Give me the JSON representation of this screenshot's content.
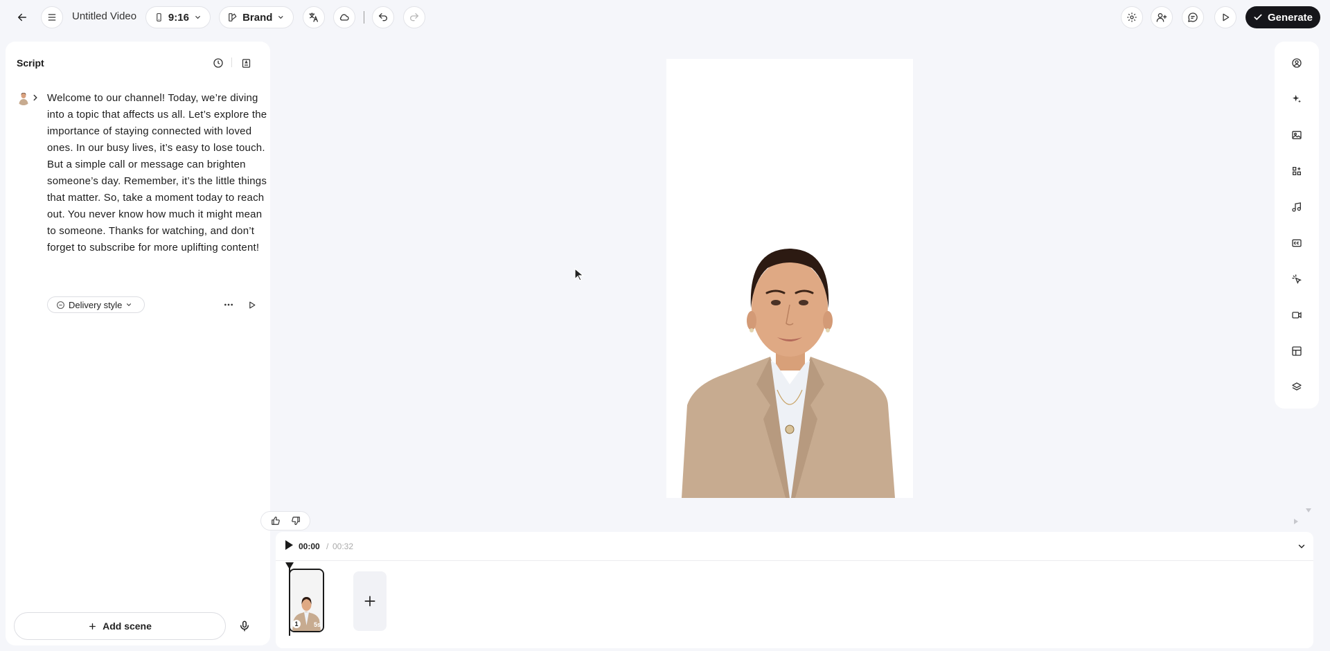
{
  "topbar": {
    "title": "Untitled Video",
    "aspect_ratio": "9:16",
    "brand_label": "Brand",
    "generate_label": "Generate"
  },
  "script": {
    "panel_title": "Script",
    "text": "Welcome to our channel! Today, we’re diving into a topic that affects us all. Let’s explore the importance of staying connected with loved ones. In our busy lives, it’s easy to lose touch. But a simple call or message can brighten someone’s day. Remember, it’s the little things that matter. So, take a moment today to reach out. You never know how much it might mean to someone. Thanks for watching, and don’t forget to subscribe for more uplifting content!",
    "delivery_style_label": "Delivery style",
    "add_scene_label": "Add scene"
  },
  "timeline": {
    "current_time": "00:00",
    "separator": "/",
    "total_time": "00:32",
    "scenes": [
      {
        "number": "1",
        "duration": "5s"
      }
    ]
  },
  "tools": [
    "avatar-icon",
    "ai-sparkle-icon",
    "image-icon",
    "elements-icon",
    "music-icon",
    "captions-icon",
    "interaction-icon",
    "video-icon",
    "layout-icon",
    "layers-icon"
  ],
  "colors": {
    "background": "#f5f6fa",
    "accent_dark": "#16161a",
    "blazer": "#c7ab90"
  }
}
